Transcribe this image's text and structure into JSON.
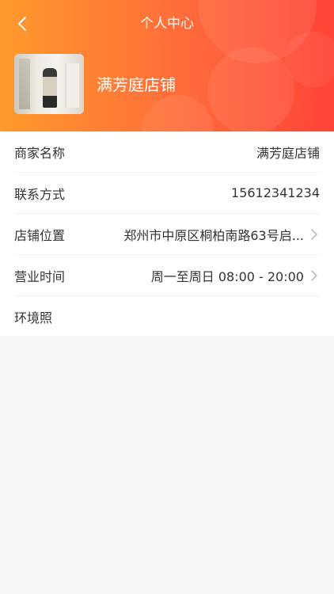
{
  "header": {
    "title": "个人中心",
    "back_icon": "chevron-left-icon"
  },
  "profile": {
    "shop_name": "满芳庭店铺",
    "avatar_alt": "店铺照片"
  },
  "info_rows": [
    {
      "label": "商家名称",
      "value": "满芳庭店铺"
    },
    {
      "label": "联系方式",
      "value": "15612341234"
    },
    {
      "label": "店铺位置",
      "value": "郑州市中原区桐柏南路63号启..."
    },
    {
      "label": "营业时间",
      "value": "周一至周日 08:00 - 20:00"
    },
    {
      "label": "环境照",
      "value": ""
    }
  ],
  "colors": {
    "header_gradient_start": "#ff9a2c",
    "header_gradient_end": "#ff4438",
    "page_bg": "#f7f7f7",
    "text": "#333333",
    "chevron": "#b5b5b5"
  }
}
